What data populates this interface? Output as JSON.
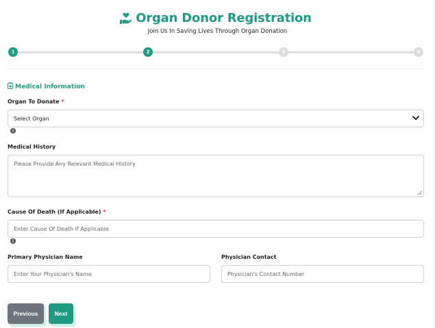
{
  "header": {
    "title": "Organ Donor Registration",
    "subtitle": "Join Us In Saving Lives Through Organ Donation",
    "icon": "hand-heart-icon"
  },
  "progress": {
    "steps": [
      "1",
      "2",
      "3",
      "4"
    ],
    "current_step": 2
  },
  "section": {
    "title": "Medical Information",
    "icon": "clipboard-icon"
  },
  "form": {
    "organ": {
      "label": "Organ To Donate",
      "required": "*",
      "value": "Select Organ"
    },
    "history": {
      "label": "Medical History",
      "placeholder": "Please Provide Any Relevant Medical History"
    },
    "cause": {
      "label": "Cause Of Death (If Applicable)",
      "required": "*",
      "placeholder": "Enter Cause Of Death If Applicable"
    },
    "physician_name": {
      "label": "Primary Physician Name",
      "placeholder": "Enter Your Physician's Name"
    },
    "physician_contact": {
      "label": "Physician Contact",
      "placeholder": "Physician's Contact Number"
    }
  },
  "buttons": {
    "previous": "Previous",
    "next": "Next"
  },
  "colors": {
    "accent": "#1f9b84",
    "secondary": "#6c757d",
    "required": "#d32f2f"
  }
}
